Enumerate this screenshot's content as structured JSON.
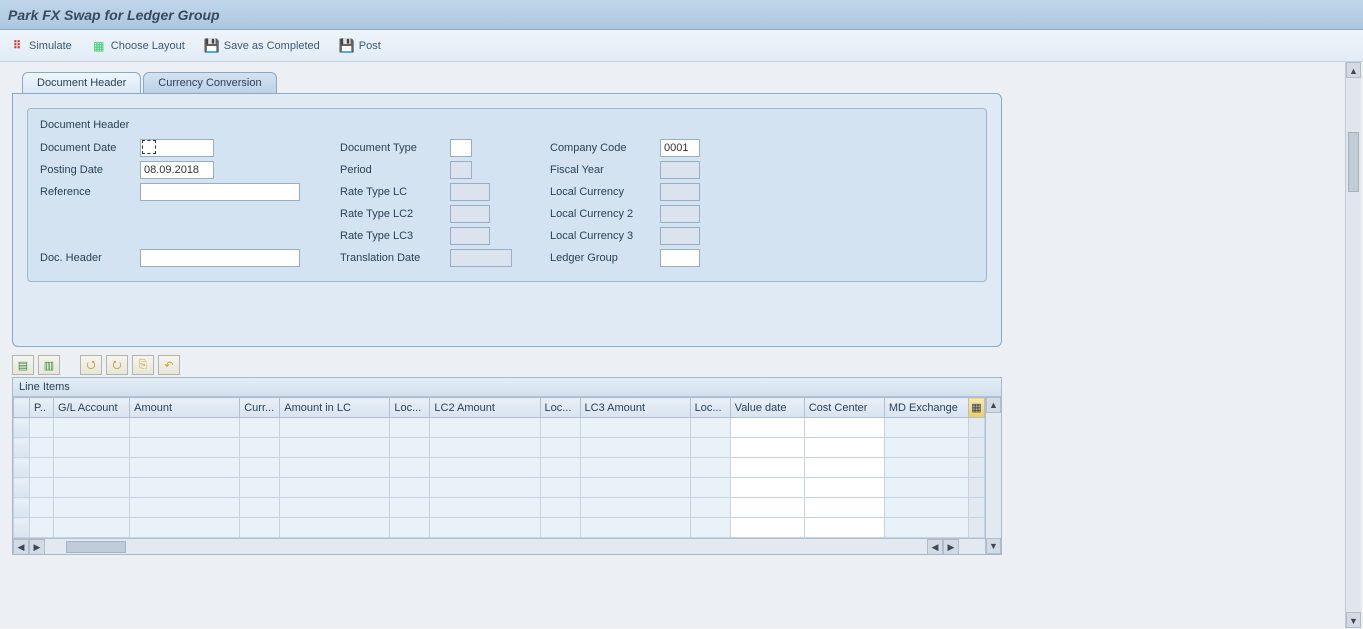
{
  "title": "Park FX Swap for Ledger Group",
  "toolbar": {
    "simulate": "Simulate",
    "choose_layout": "Choose Layout",
    "save_completed": "Save as Completed",
    "post": "Post"
  },
  "tabs": {
    "header": "Document Header",
    "currency": "Currency Conversion"
  },
  "groupbox": {
    "legend": "Document Header",
    "labels": {
      "doc_date": "Document Date",
      "posting_date": "Posting Date",
      "reference": "Reference",
      "doc_header": "Doc. Header",
      "doc_type": "Document Type",
      "period": "Period",
      "rate_lc": "Rate Type LC",
      "rate_lc2": "Rate Type LC2",
      "rate_lc3": "Rate Type LC3",
      "trans_date": "Translation Date",
      "company": "Company Code",
      "fiscal": "Fiscal Year",
      "local1": "Local Currency",
      "local2": "Local Currency 2",
      "local3": "Local Currency 3",
      "ledger": "Ledger Group"
    },
    "values": {
      "doc_date": "",
      "posting_date": "08.09.2018",
      "reference": "",
      "doc_header": "",
      "doc_type": "",
      "period": "",
      "rate_lc": "",
      "rate_lc2": "",
      "rate_lc3": "",
      "trans_date": "",
      "company": "0001",
      "fiscal": "",
      "local1": "",
      "local2": "",
      "local3": "",
      "ledger": ""
    }
  },
  "lineitems": {
    "title": "Line Items",
    "columns": {
      "pk": "P..",
      "gl": "G/L Account",
      "amount": "Amount",
      "curr": "Curr...",
      "amt_lc": "Amount in LC",
      "loc1": "Loc...",
      "lc2amt": "LC2 Amount",
      "loc2": "Loc...",
      "lc3amt": "LC3 Amount",
      "loc3": "Loc...",
      "valdate": "Value date",
      "costc": "Cost Center",
      "mdex": "MD Exchange"
    },
    "rows": [
      {},
      {},
      {},
      {},
      {},
      {}
    ]
  }
}
